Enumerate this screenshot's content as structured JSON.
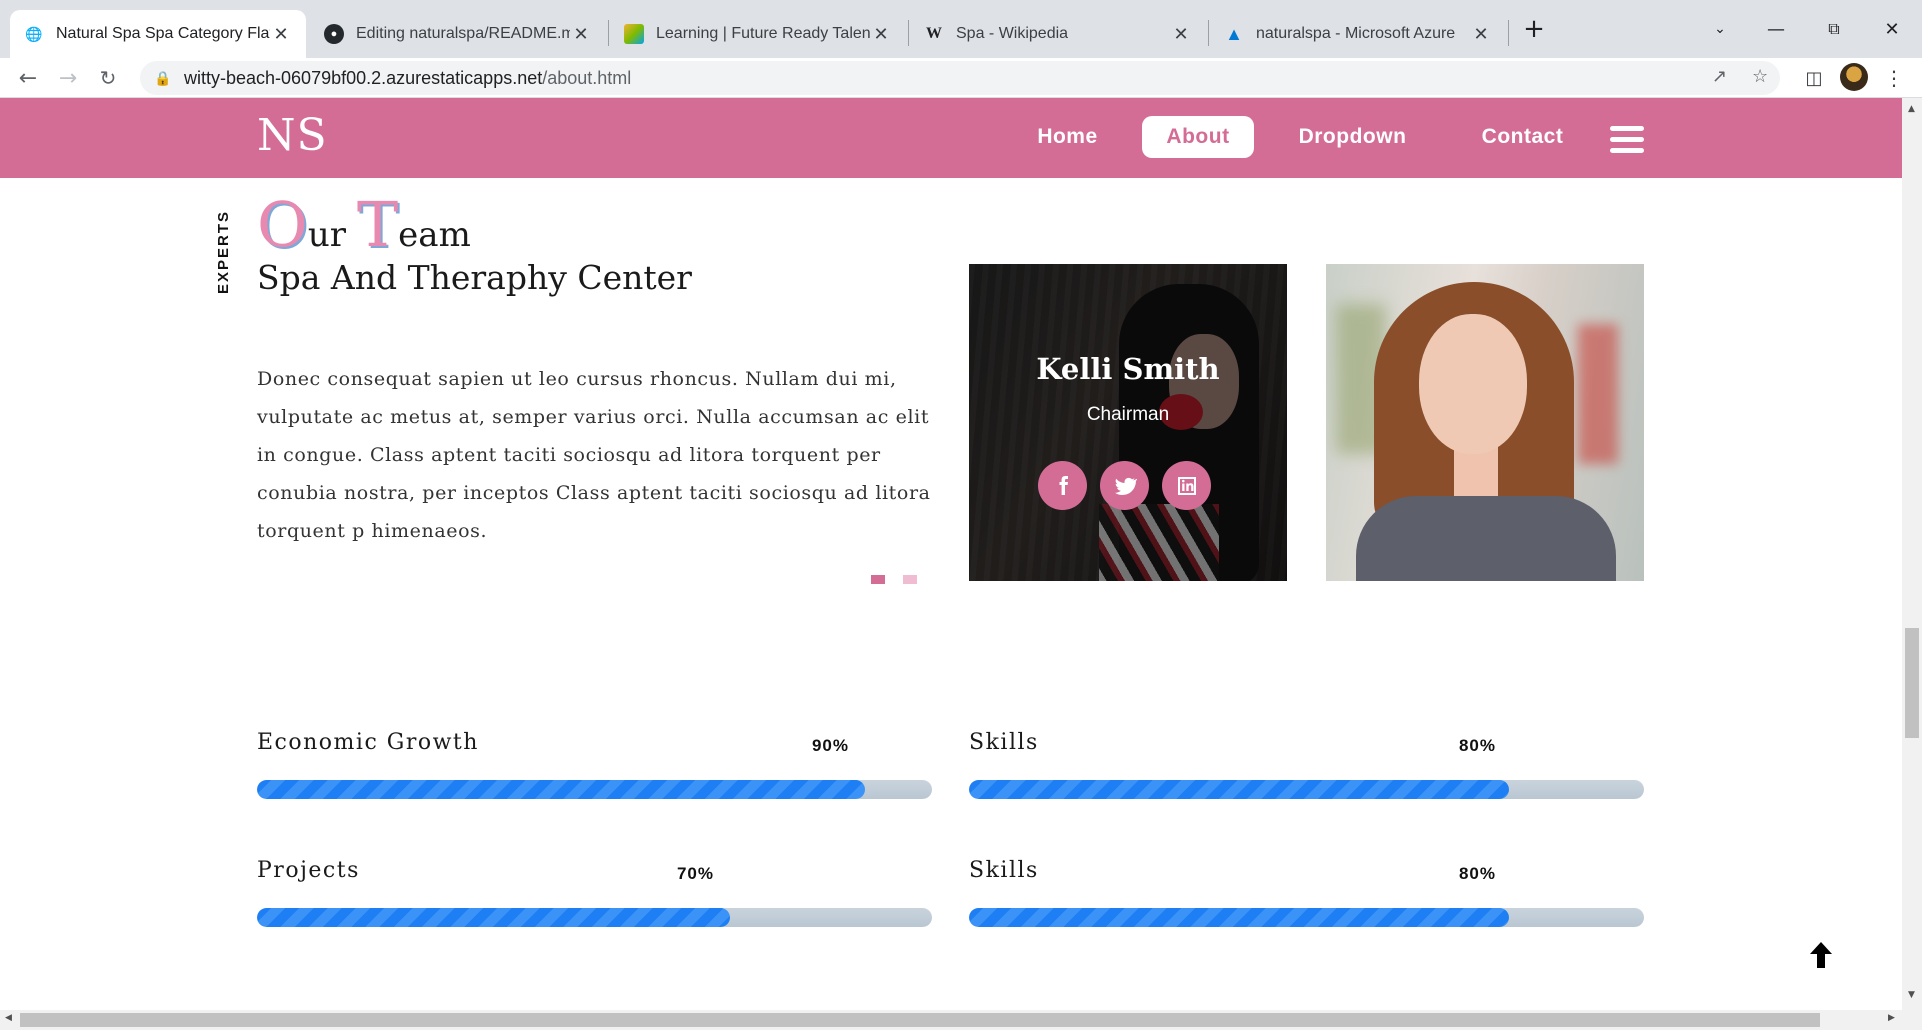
{
  "browser": {
    "tabs": [
      {
        "title": "Natural Spa Spa Category Flat Bo",
        "favicon": "globe-icon",
        "active": true
      },
      {
        "title": "Editing naturalspa/README.md a",
        "favicon": "github-icon",
        "active": false
      },
      {
        "title": "Learning | Future Ready Talent",
        "favicon": "learning-icon",
        "active": false
      },
      {
        "title": "Spa - Wikipedia",
        "favicon": "wikipedia-icon",
        "active": false
      },
      {
        "title": "naturalspa - Microsoft Azure",
        "favicon": "azure-icon",
        "active": false
      }
    ],
    "url_host": "witty-beach-06079bf00.2.azurestaticapps.net",
    "url_path": "/about.html"
  },
  "nav": {
    "logo": "NS",
    "links": [
      {
        "label": "Home",
        "active": false
      },
      {
        "label": "About",
        "active": true
      },
      {
        "label": "Dropdown",
        "active": false
      },
      {
        "label": "Contact",
        "active": false
      }
    ]
  },
  "team": {
    "side_label": "EXPERTS",
    "title_o": "O",
    "title_ur": "ur ",
    "title_t": "T",
    "title_eam": "eam",
    "subtitle": "Spa And Theraphy Center",
    "text": "Donec consequat sapien ut leo cursus rhoncus. Nullam dui mi, vulputate ac metus at, semper varius orci. Nulla accumsan ac elit in congue. Class aptent taciti sociosqu ad litora torquent per conubia nostra, per inceptos Class aptent taciti sociosqu ad litora torquent p himenaeos.",
    "members": [
      {
        "name": "Kelli Smith",
        "role": "Chairman",
        "socials": [
          "facebook-icon",
          "twitter-icon",
          "linkedin-icon"
        ]
      }
    ]
  },
  "progress": [
    {
      "label": "Economic Growth",
      "percent_text": "90%",
      "value": 0.9
    },
    {
      "label": "Skills",
      "percent_text": "80%",
      "value": 0.8
    },
    {
      "label": "Projects",
      "percent_text": "70%",
      "value": 0.7
    },
    {
      "label": "Skills",
      "percent_text": "80%",
      "value": 0.8
    }
  ],
  "colors": {
    "brand_pink": "#d46d96",
    "bar_blue": "#1e7ff5"
  }
}
